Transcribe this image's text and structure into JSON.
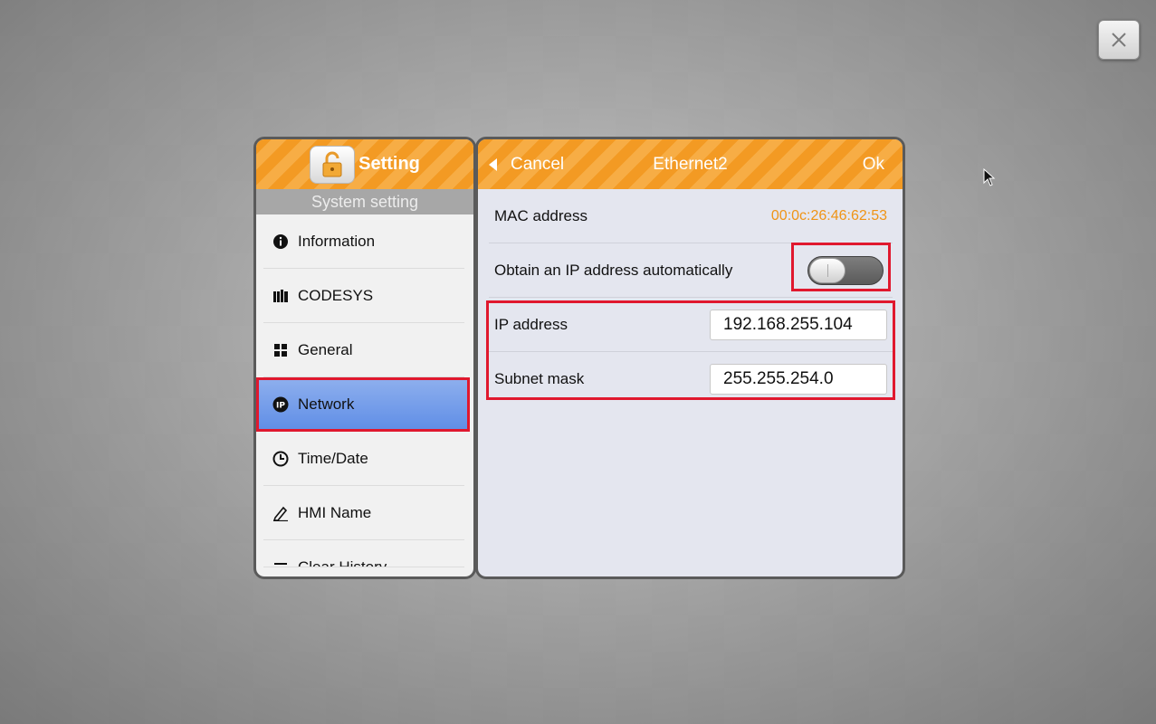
{
  "sidebar": {
    "title": "Setting",
    "subtitle": "System setting",
    "items": [
      {
        "label": "Information",
        "icon": "info-icon"
      },
      {
        "label": "CODESYS",
        "icon": "codesys-icon"
      },
      {
        "label": "General",
        "icon": "grid-icon"
      },
      {
        "label": "Network",
        "icon": "ip-icon",
        "selected": true
      },
      {
        "label": "Time/Date",
        "icon": "clock-icon"
      },
      {
        "label": "HMI Name",
        "icon": "pen-icon"
      },
      {
        "label": "Clear History",
        "icon": "list-icon"
      }
    ]
  },
  "panel": {
    "cancel_label": "Cancel",
    "title": "Ethernet2",
    "ok_label": "Ok",
    "mac_label": "MAC address",
    "mac_value": "00:0c:26:46:62:53",
    "dhcp_label": "Obtain an IP address automatically",
    "dhcp_enabled": false,
    "ip_label": "IP address",
    "ip_value": "192.168.255.104",
    "subnet_label": "Subnet mask",
    "subnet_value": "255.255.254.0"
  },
  "colors": {
    "accent": "#f39a23",
    "highlight": "#e0182e",
    "selected": "#6b96e8",
    "mac_text": "#ef9416"
  }
}
